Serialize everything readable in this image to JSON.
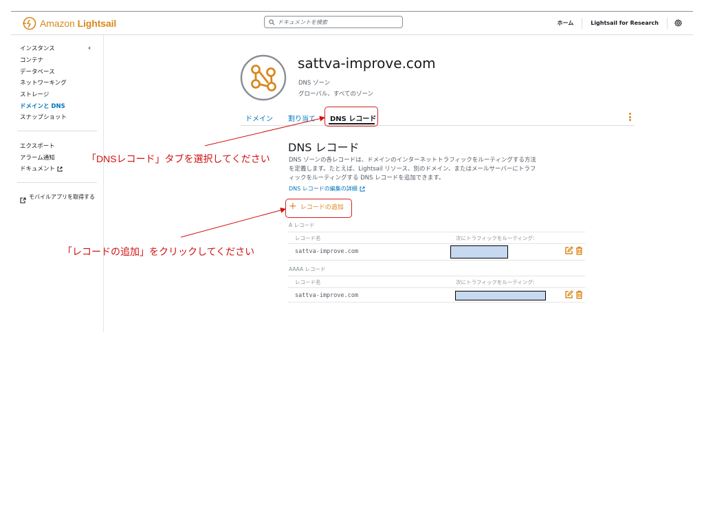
{
  "header": {
    "brand_prefix": "Amazon",
    "brand_name": "Lightsail",
    "search_placeholder": "ドキュメントを検索",
    "nav": {
      "home": "ホーム",
      "research": "Lightsail for Research"
    }
  },
  "sidebar": {
    "items": [
      {
        "label": "インスタンス"
      },
      {
        "label": "コンテナ"
      },
      {
        "label": "データベース"
      },
      {
        "label": "ネットワーキング"
      },
      {
        "label": "ストレージ"
      },
      {
        "label": "ドメインと DNS"
      },
      {
        "label": "スナップショット"
      }
    ],
    "secondary": [
      {
        "label": "エクスポート"
      },
      {
        "label": "アラーム通知"
      },
      {
        "label": "ドキュメント"
      }
    ],
    "mobile_app": "モバイルアプリを取得する"
  },
  "zone": {
    "title": "sattva-improve.com",
    "subtitle": "DNS ゾーン",
    "scope": "グローバル、すべてのゾーン"
  },
  "tabs": [
    {
      "label": "ドメイン"
    },
    {
      "label": "割り当て"
    },
    {
      "label": "DNS レコード",
      "selected": true
    }
  ],
  "section": {
    "title": "DNS レコード",
    "description": "DNS ゾーンの各レコードは、ドメインのインターネットトラフィックをルーティングする方法を定義します。たとえば、Lightsail リソース、別のドメイン、またはメールサーバーにトラフィックをルーティングする DNS レコードを追加できます。",
    "learn_more": "DNS レコードの編集の詳細",
    "add_button": "レコードの追加"
  },
  "record_groups": [
    {
      "label": "A レコード",
      "col_name": "レコード名",
      "col_target": "次にトラフィックをルーティング:",
      "rows": [
        {
          "name": "sattva-improve.com",
          "target": ""
        }
      ]
    },
    {
      "label": "AAAA レコード",
      "col_name": "レコード名",
      "col_target": "次にトラフィックをルーティング:",
      "rows": [
        {
          "name": "sattva-improve.com",
          "target": ""
        }
      ]
    }
  ],
  "annotations": {
    "select_tab": "「DNSレコード」タブを選択してください",
    "click_add": "「レコードの追加」をクリックしてください"
  },
  "colors": {
    "accent_orange": "#d9881b",
    "link_blue": "#0073bb",
    "annotation_red": "#cf1111",
    "masked_fill": "#c6d9f0"
  }
}
